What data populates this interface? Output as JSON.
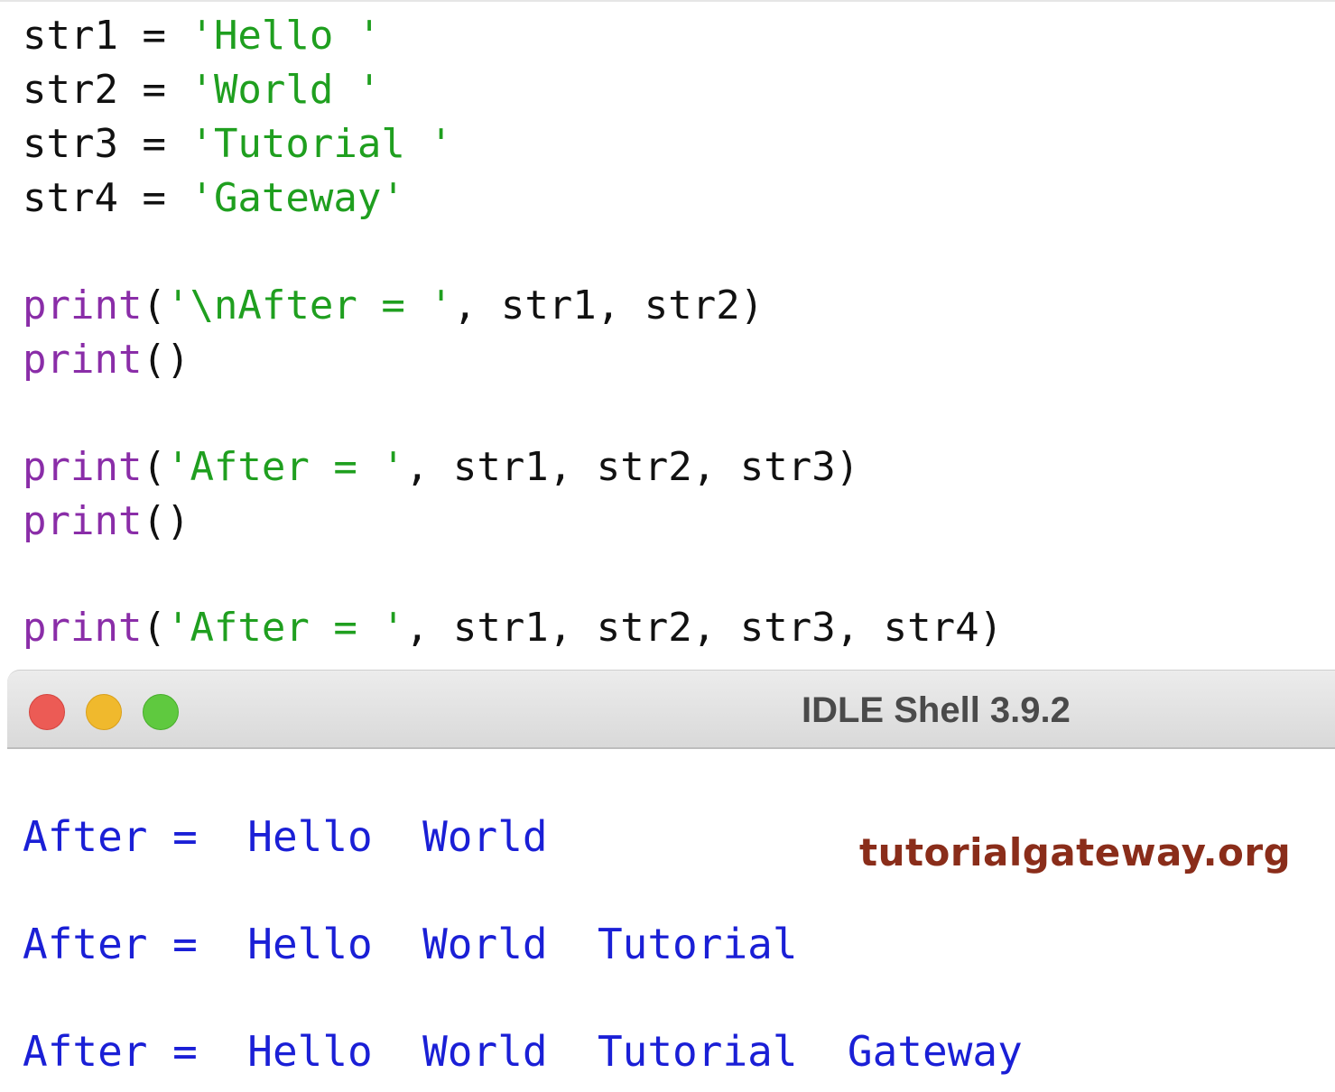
{
  "editor": {
    "lines": [
      {
        "id": "str1",
        "name": "str1",
        "op": " = ",
        "value": "'Hello '"
      },
      {
        "id": "str2",
        "name": "str2",
        "op": " = ",
        "value": "'World '"
      },
      {
        "id": "str3",
        "name": "str3",
        "op": " = ",
        "value": "'Tutorial '"
      },
      {
        "id": "str4",
        "name": "str4",
        "op": " = ",
        "value": "'Gateway'"
      }
    ],
    "print1": {
      "kw": "print",
      "open": "(",
      "str": "'\\nAfter = '",
      "rest": ", str1, str2)"
    },
    "print2": {
      "kw": "print",
      "rest": "()"
    },
    "print3": {
      "kw": "print",
      "open": "(",
      "str": "'After = '",
      "rest": ", str1, str2, str3)"
    },
    "print4": {
      "kw": "print",
      "rest": "()"
    },
    "print5": {
      "kw": "print",
      "open": "(",
      "str": "'After = '",
      "rest": ", str1, str2, str3, str4)"
    }
  },
  "shell": {
    "title": "IDLE Shell 3.9.2",
    "output": [
      "After =  Hello  World",
      "After =  Hello  World  Tutorial",
      "After =  Hello  World  Tutorial  Gateway"
    ],
    "watermark": "tutorialgateway.org"
  },
  "colors": {
    "string": "#1f9f1f",
    "keyword": "#8a2da8",
    "output": "#1a1fd6",
    "watermark": "#8a2d1a"
  }
}
